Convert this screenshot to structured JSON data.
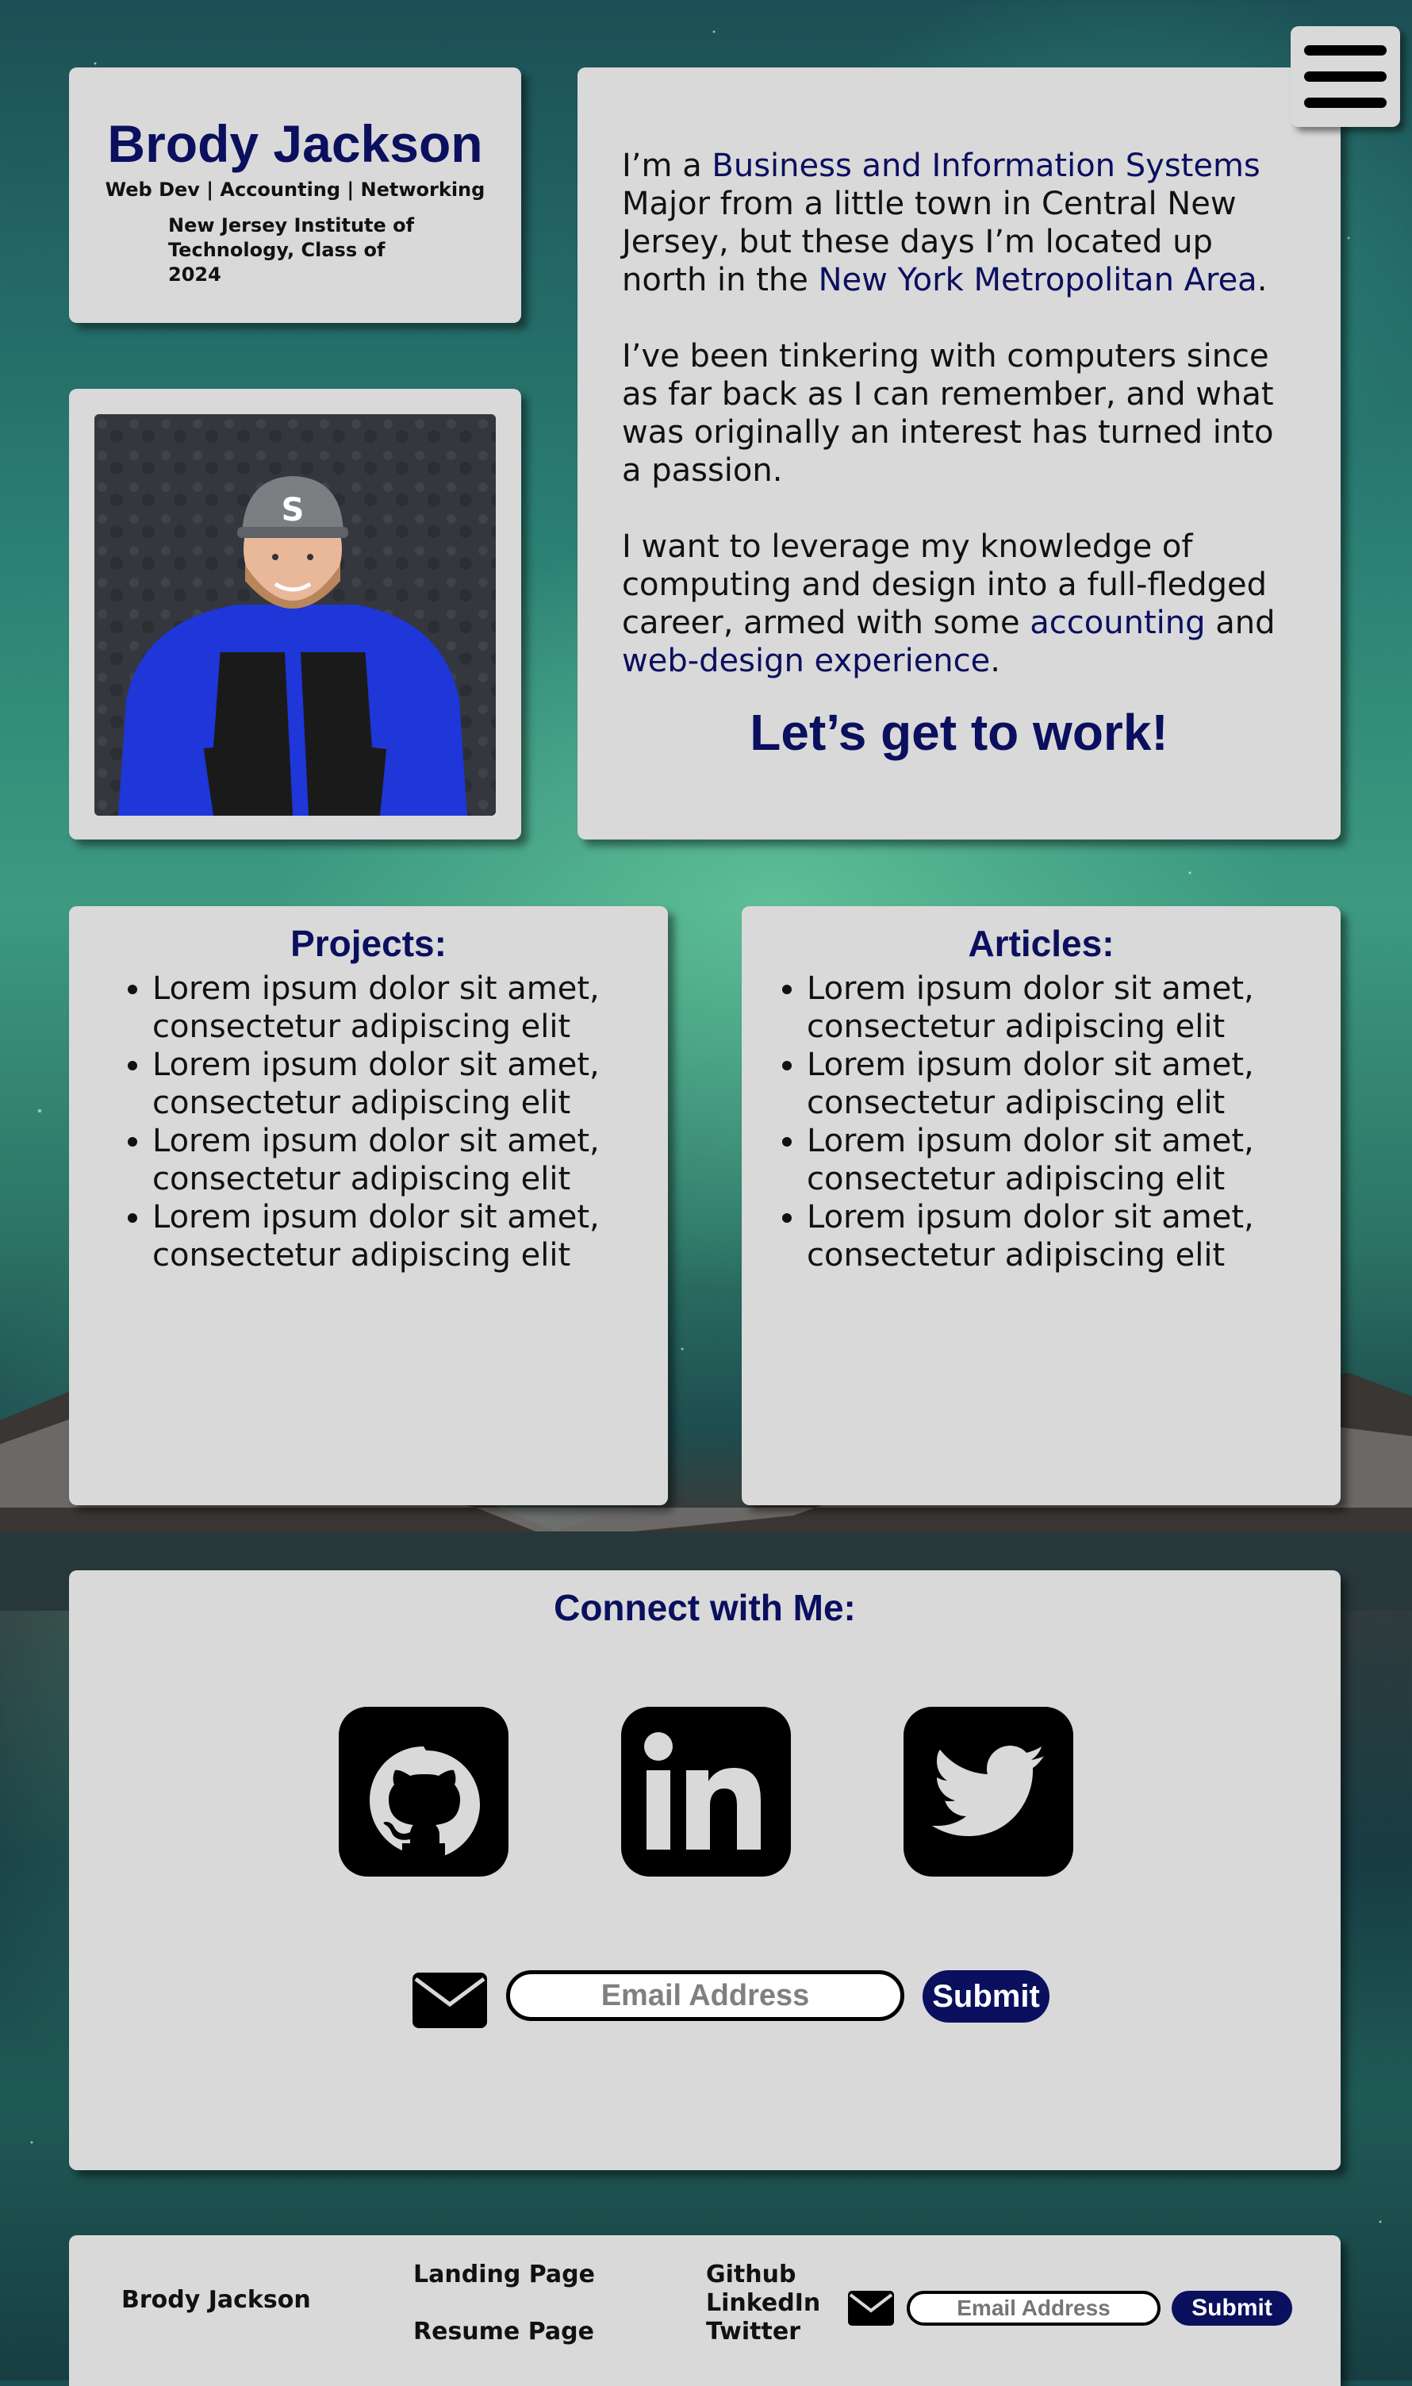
{
  "header": {
    "name": "Brody Jackson",
    "tagline": "Web Dev | Accounting | Networking",
    "school": "New Jersey Institute of Technology, Class of 2024"
  },
  "menu": {
    "icon": "hamburger-menu-icon"
  },
  "bio": {
    "p1_prefix": "I’m a ",
    "p1_link1": "Business and Information Systems",
    "p1_middle": " Major from a little town in Central New Jersey, but these days I’m located up north in the ",
    "p1_link2": "New York Metropolitan Area",
    "p1_suffix": ".",
    "p2": "I’ve been tinkering with computers since as far back as I can remember, and what was originally an interest has turned into a passion.",
    "p3_prefix": "I want to leverage my knowledge of computing and design into a full-fledged career, armed with some ",
    "p3_link1": "accounting",
    "p3_middle": " and ",
    "p3_link2": "web-design experience",
    "p3_suffix": ".",
    "cta": "Let’s get to work!"
  },
  "projects": {
    "title": "Projects:",
    "items": [
      "Lorem ipsum dolor sit amet, consectetur adipiscing elit",
      "Lorem ipsum dolor sit amet, consectetur adipiscing elit",
      "Lorem ipsum dolor sit amet, consectetur adipiscing elit",
      "Lorem ipsum dolor sit amet, consectetur adipiscing elit"
    ]
  },
  "articles": {
    "title": "Articles:",
    "items": [
      "Lorem ipsum dolor sit amet, consectetur adipiscing elit",
      "Lorem ipsum dolor sit amet, consectetur adipiscing elit",
      "Lorem ipsum dolor sit amet, consectetur adipiscing elit",
      "Lorem ipsum dolor sit amet, consectetur adipiscing elit"
    ]
  },
  "connect": {
    "title": "Connect with Me:",
    "socials": [
      "github-icon",
      "linkedin-icon",
      "twitter-icon"
    ],
    "email_placeholder": "Email Address",
    "submit_label": "Submit"
  },
  "footer": {
    "name": "Brody Jackson",
    "landing_link": "Landing Page",
    "resume_link": "Resume Page",
    "github_link": "Github",
    "linkedin_link": "LinkedIn",
    "twitter_link": "Twitter",
    "email_placeholder": "Email Address",
    "submit_label": "Submit"
  },
  "colors": {
    "accent": "#0a0f5e",
    "card": "#d9d9d9"
  }
}
